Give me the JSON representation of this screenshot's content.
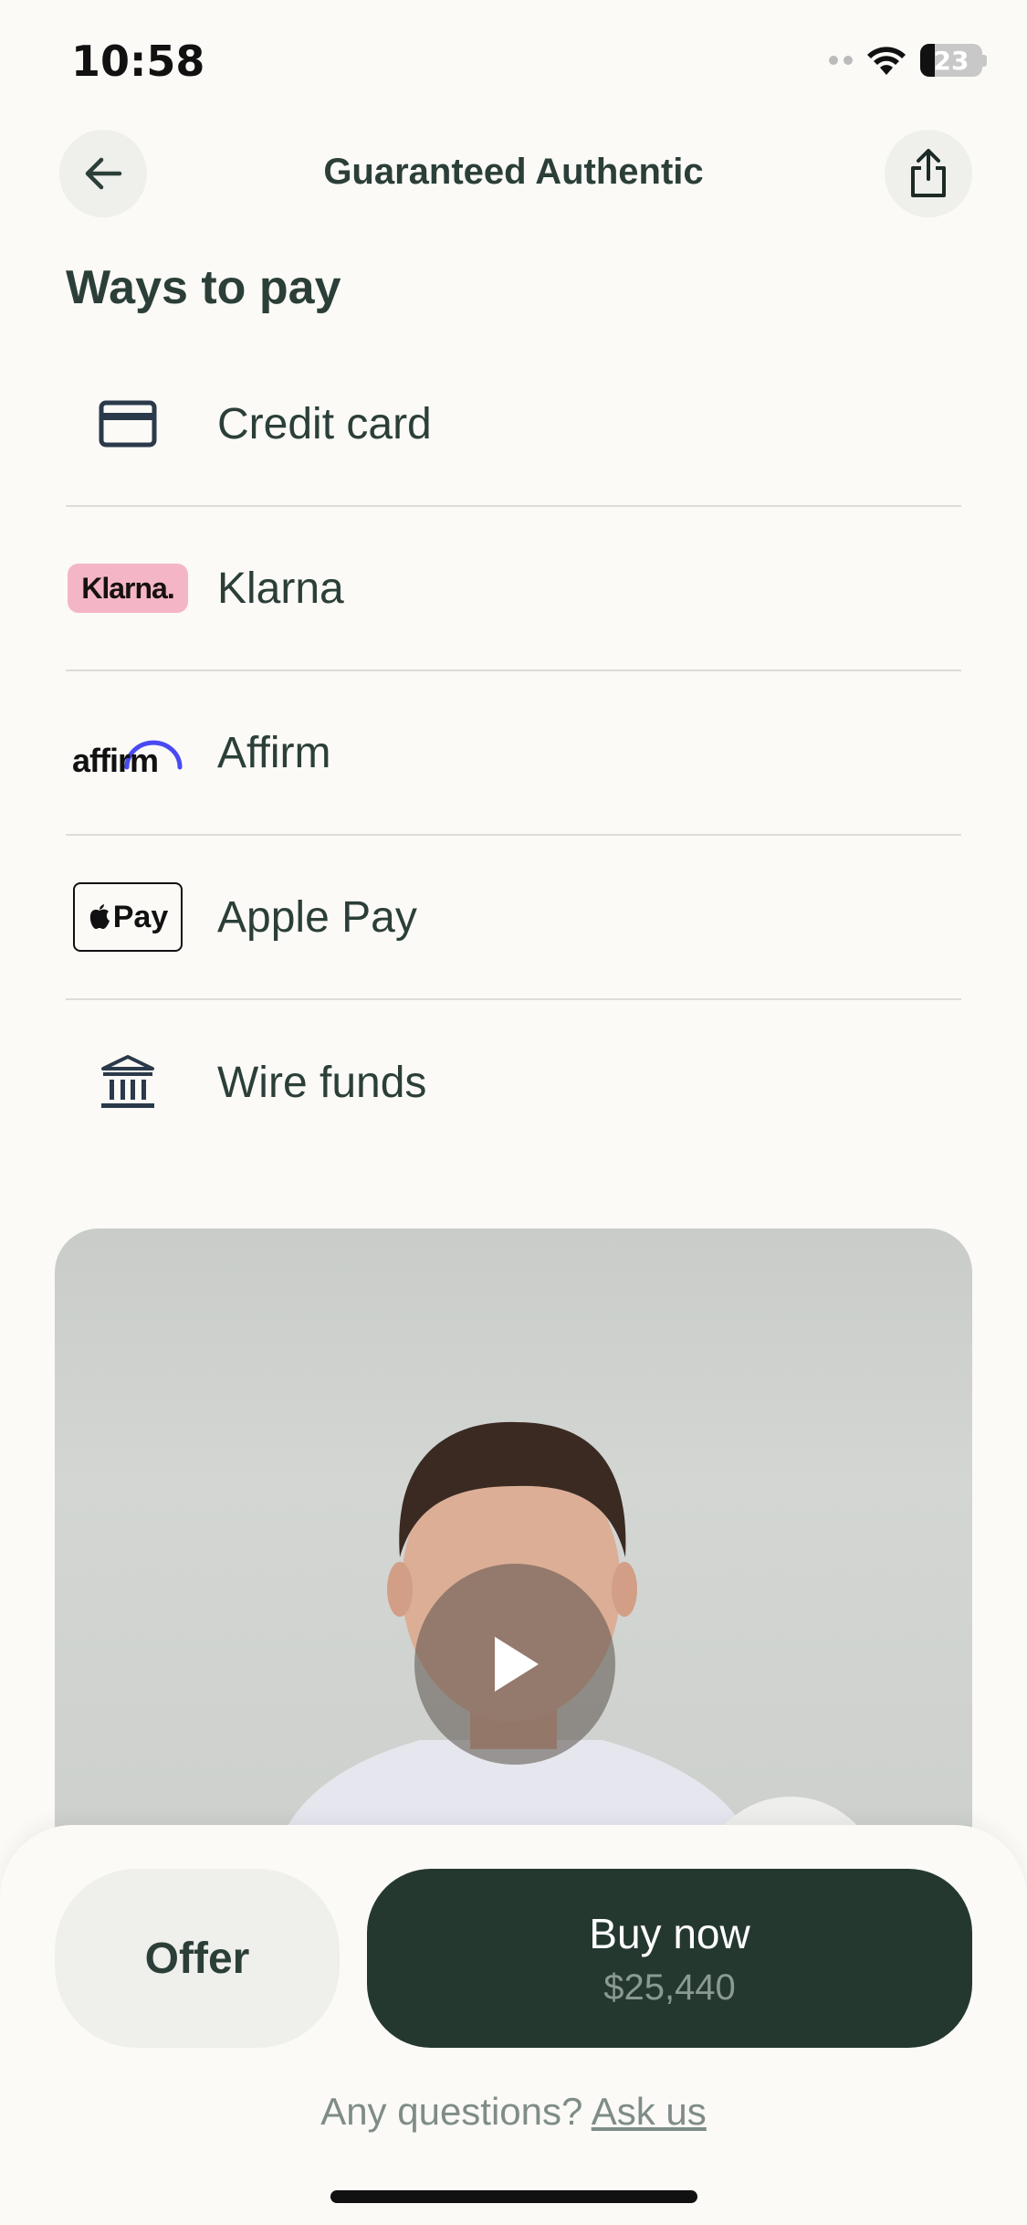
{
  "status_bar": {
    "time": "10:58",
    "battery_level": "23"
  },
  "nav": {
    "title": "Guaranteed Authentic",
    "back_icon": "arrow-left-icon",
    "share_icon": "share-icon"
  },
  "section": {
    "title": "Ways to pay"
  },
  "payment_methods": [
    {
      "label": "Credit card",
      "icon": "credit-card-icon"
    },
    {
      "label": "Klarna",
      "icon": "klarna-logo",
      "logo_text": "Klarna."
    },
    {
      "label": "Affirm",
      "icon": "affirm-logo",
      "logo_text": "affirm"
    },
    {
      "label": "Apple Pay",
      "icon": "apple-pay-logo",
      "logo_text": "Pay"
    },
    {
      "label": "Wire funds",
      "icon": "bank-icon"
    }
  ],
  "video": {
    "play_icon": "play-icon"
  },
  "bottom_bar": {
    "offer_label": "Offer",
    "buy_label": "Buy now",
    "price": "$25,440",
    "questions_text": "Any questions?",
    "ask_link": "Ask us"
  },
  "colors": {
    "background": "#fbfaf7",
    "primary_dark": "#243830",
    "text": "#2b3f38",
    "klarna_pink": "#f4b6c7",
    "affirm_purple": "#4a4af4"
  }
}
